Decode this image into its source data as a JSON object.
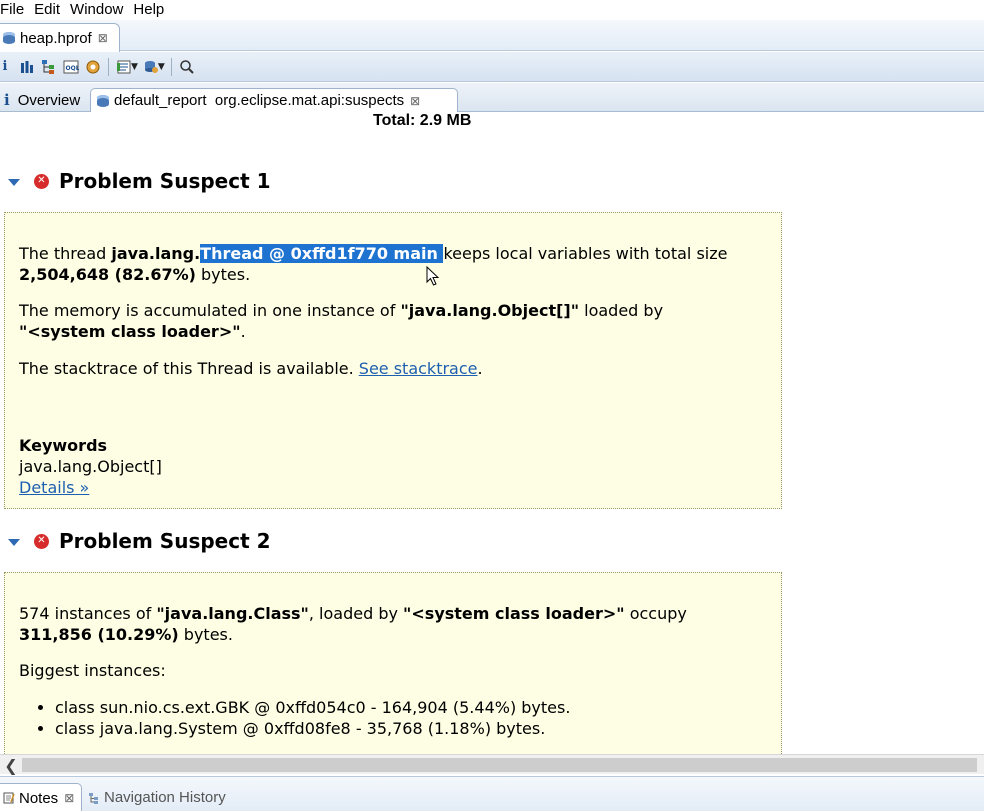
{
  "menu": [
    "File",
    "Edit",
    "Window",
    "Help"
  ],
  "editor_tab": {
    "label": "heap.hprof",
    "close": "⊠"
  },
  "toolbar": {
    "icons": [
      "info-icon",
      "histogram-icon",
      "dominator-tree-icon",
      "oql-icon",
      "thread-overview-icon",
      "query-browser-icon",
      "heap-dump-overview-icon",
      "search-icon"
    ]
  },
  "report_tabs": {
    "overview": "Overview",
    "report": "default_report  org.eclipse.mat.api:suspects",
    "close": "⊠"
  },
  "total_line": "Total: 2.9 MB",
  "suspect1": {
    "title": "Problem Suspect 1",
    "p1_prefix": "The thread ",
    "p1_bold_pkg": "java.lang.",
    "p1_selected": "Thread @ 0xffd1f770 main ",
    "p1_mid": "keeps local variables with total size",
    "p1_bold_size": "2,504,648 (82.67%)",
    "p1_suffix": " bytes.",
    "p2_prefix": "The memory is accumulated in one instance of ",
    "p2_bold_class": "\"java.lang.Object[]\"",
    "p2_mid": " loaded by",
    "p2_bold_loader": "\"<system class loader>\"",
    "p2_suffix": ".",
    "p3_prefix": "The stacktrace of this Thread is available. ",
    "p3_link": "See stacktrace",
    "p3_suffix": ".",
    "keywords_label": "Keywords",
    "keyword": "java.lang.Object[]",
    "details_link": "Details »"
  },
  "suspect2": {
    "title": "Problem Suspect 2",
    "p1_prefix": "574 instances of ",
    "p1_bold_class": "\"java.lang.Class\"",
    "p1_mid": ", loaded by ",
    "p1_bold_loader": "\"<system class loader>\"",
    "p1_suffix": " occupy",
    "p1_bold_size": "311,856 (10.29%)",
    "p1_end": " bytes.",
    "biggest_label": "Biggest instances:",
    "instances": [
      "class sun.nio.cs.ext.GBK @ 0xffd054c0 - 164,904 (5.44%) bytes.",
      "class java.lang.System @ 0xffd08fe8 - 35,768 (1.18%) bytes."
    ]
  },
  "bottom_tabs": {
    "notes": "Notes",
    "notes_close": "⊠",
    "nav_history": "Navigation History"
  }
}
